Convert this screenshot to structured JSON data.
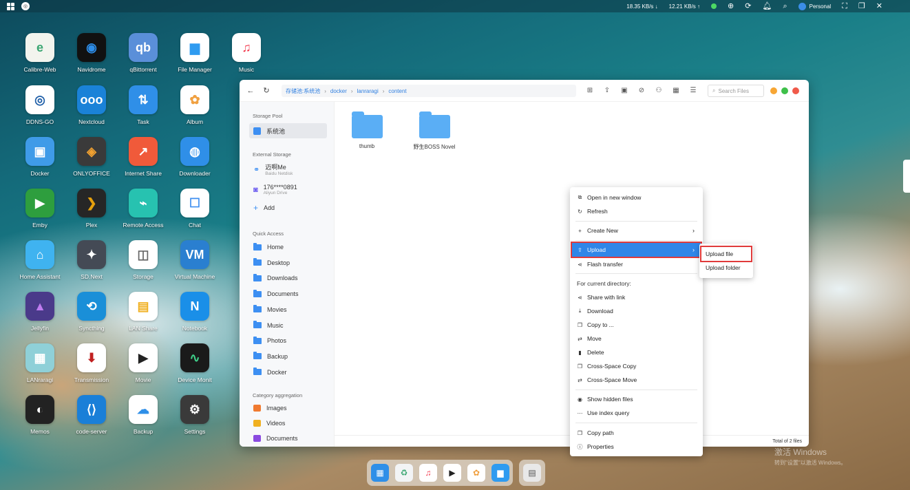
{
  "taskbar": {
    "download_speed": "18.35 KB/s",
    "upload_speed": "12.21 KB/s",
    "user": "Personal",
    "notification_badge": "1"
  },
  "desktop_apps": [
    {
      "label": "Calibre-Web",
      "color": "#f2f4ee",
      "glyph": "e",
      "fg": "#3aa672"
    },
    {
      "label": "Navidrome",
      "color": "#111111",
      "glyph": "◉",
      "fg": "#2d8de8"
    },
    {
      "label": "qBittorrent",
      "color": "#5a8fd9",
      "glyph": "qb",
      "fg": "#ffffff"
    },
    {
      "label": "File Manager",
      "color": "#ffffff",
      "glyph": "▆",
      "fg": "#2f9bf0"
    },
    {
      "label": "Music",
      "color": "#ffffff",
      "glyph": "♫",
      "fg": "#f23a4e"
    },
    {
      "label": "DDNS-GO",
      "color": "#ffffff",
      "glyph": "◎",
      "fg": "#1f5fa8"
    },
    {
      "label": "Nextcloud",
      "color": "#1a82d8",
      "glyph": "ooo",
      "fg": "#ffffff"
    },
    {
      "label": "Task",
      "color": "#2f8fe8",
      "glyph": "⇅",
      "fg": "#ffffff"
    },
    {
      "label": "Album",
      "color": "#ffffff",
      "glyph": "✿",
      "fg": "#f0a040"
    },
    {
      "label": "Docker",
      "color": "#3f9be8",
      "glyph": "▣",
      "fg": "#ffffff"
    },
    {
      "label": "ONLYOFFICE",
      "color": "#3a3a3a",
      "glyph": "◈",
      "fg": "#f0a030"
    },
    {
      "label": "Internet Share",
      "color": "#f05a3a",
      "glyph": "↗",
      "fg": "#ffffff"
    },
    {
      "label": "Downloader",
      "color": "#2f8fe8",
      "glyph": "◍",
      "fg": "#ffffff"
    },
    {
      "label": "Emby",
      "color": "#2e9e3e",
      "glyph": "▶",
      "fg": "#ffffff"
    },
    {
      "label": "Plex",
      "color": "#262626",
      "glyph": "❯",
      "fg": "#e5a00d"
    },
    {
      "label": "Remote Access",
      "color": "#27c2b0",
      "glyph": "⌁",
      "fg": "#ffffff"
    },
    {
      "label": "Chat",
      "color": "#ffffff",
      "glyph": "☐",
      "fg": "#3f8ff0"
    },
    {
      "label": "Home Assistant",
      "color": "#3fb3f0",
      "glyph": "⌂",
      "fg": "#ffffff"
    },
    {
      "label": "SD.Next",
      "color": "#444a55",
      "glyph": "✦",
      "fg": "#ffffff"
    },
    {
      "label": "Storage",
      "color": "#ffffff",
      "glyph": "◫",
      "fg": "#666666"
    },
    {
      "label": "Virtual Machine",
      "color": "#2a7fd0",
      "glyph": "VM",
      "fg": "#ffffff"
    },
    {
      "label": "Jellyfin",
      "color": "#4a3a8a",
      "glyph": "▲",
      "fg": "#c07cf0"
    },
    {
      "label": "Syncthing",
      "color": "#1a8fd8",
      "glyph": "⟲",
      "fg": "#ffffff"
    },
    {
      "label": "LAN Share",
      "color": "#ffffff",
      "glyph": "▤",
      "fg": "#f0b020"
    },
    {
      "label": "Notebook",
      "color": "#1a8fe8",
      "glyph": "N",
      "fg": "#ffffff"
    },
    {
      "label": "LANraragi",
      "color": "#8fd0d8",
      "glyph": "▦",
      "fg": "#ffffff"
    },
    {
      "label": "Transmission",
      "color": "#ffffff",
      "glyph": "⬇",
      "fg": "#c02020"
    },
    {
      "label": "Movie",
      "color": "#ffffff",
      "glyph": "▶",
      "fg": "#222222"
    },
    {
      "label": "Device Monit",
      "color": "#1a1a1a",
      "glyph": "∿",
      "fg": "#3fd08a"
    },
    {
      "label": "Memos",
      "color": "#222222",
      "glyph": "◐",
      "fg": "#ffffff"
    },
    {
      "label": "code-server",
      "color": "#1a7fd8",
      "glyph": "⟨⟩",
      "fg": "#ffffff"
    },
    {
      "label": "Backup",
      "color": "#ffffff",
      "glyph": "☁",
      "fg": "#2f8fe8"
    },
    {
      "label": "Settings",
      "color": "#3a3a3a",
      "glyph": "⚙",
      "fg": "#ffffff"
    }
  ],
  "file_manager": {
    "breadcrumb": [
      "存储池:系统池",
      "docker",
      "lanraragi",
      "content"
    ],
    "search_placeholder": "Search Files",
    "sidebar": {
      "storage_pool_heading": "Storage Pool",
      "storage_pool_item": "系统池",
      "external_heading": "External Storage",
      "external_items": [
        {
          "name": "迈啊Me",
          "sub": "Baidu Netdisk"
        },
        {
          "name": "176****0891",
          "sub": "Aliyun Drive"
        }
      ],
      "add_label": "Add",
      "quick_heading": "Quick Access",
      "quick_items": [
        "Home",
        "Desktop",
        "Downloads",
        "Documents",
        "Movies",
        "Music",
        "Photos",
        "Backup",
        "Docker"
      ],
      "category_heading": "Category aggregation",
      "category_items": [
        {
          "label": "Images",
          "color": "#f07a30"
        },
        {
          "label": "Videos",
          "color": "#f0b020"
        },
        {
          "label": "Documents",
          "color": "#8a4ae0"
        }
      ]
    },
    "files": [
      "thumb",
      "野生BOSS Novel"
    ],
    "status": "Total of 2 files"
  },
  "context_menu": {
    "open_new_window": "Open in new window",
    "refresh": "Refresh",
    "create_new": "Create New",
    "upload": "Upload",
    "flash_transfer": "Flash transfer",
    "current_dir_label": "For current directory:",
    "share_with_link": "Share with link",
    "download": "Download",
    "copy_to": "Copy to ...",
    "move": "Move",
    "delete": "Delete",
    "cross_space_copy": "Cross-Space Copy",
    "cross_space_move": "Cross-Space Move",
    "show_hidden": "Show hidden files",
    "use_index": "Use index query",
    "copy_path": "Copy path",
    "properties": "Properties"
  },
  "upload_submenu": {
    "upload_file": "Upload file",
    "upload_folder": "Upload folder"
  },
  "watermark": {
    "line1": "激活 Windows",
    "line2": "转到\"设置\"以激活 Windows。"
  },
  "colors": {
    "accent": "#2f86e8",
    "highlight_outline": "#e03a3a",
    "close": "#f05a4a",
    "minimize": "#f7a634",
    "maximize": "#3fc04a"
  }
}
